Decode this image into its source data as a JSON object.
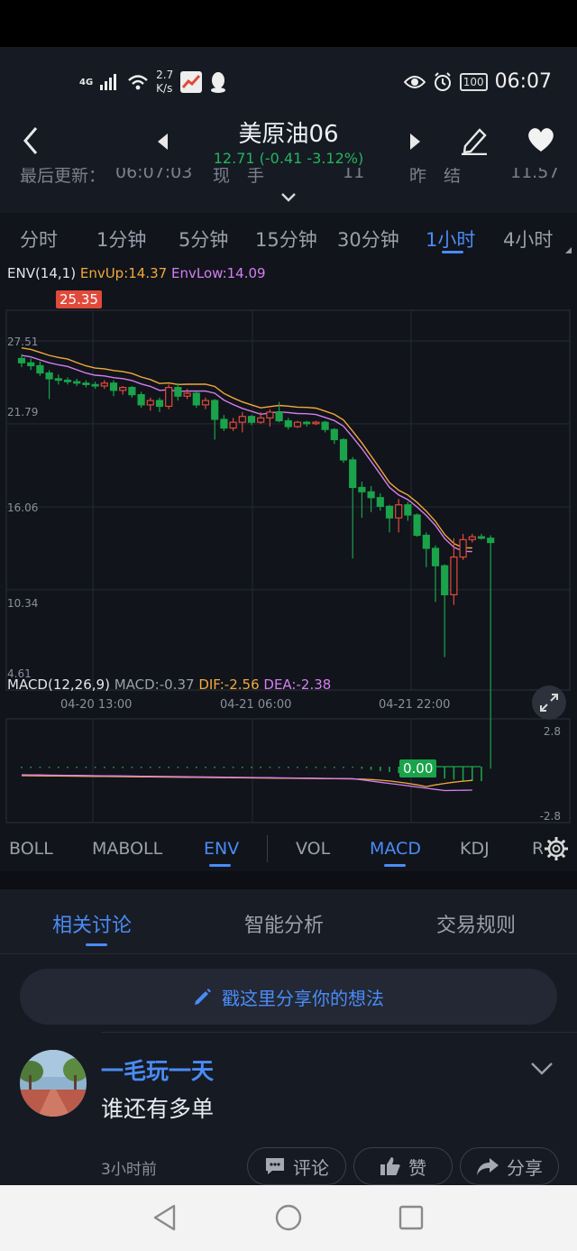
{
  "status_bar": {
    "network": "4G",
    "speed_value": "2.7",
    "speed_unit": "K/s",
    "battery": "100",
    "time": "06:07"
  },
  "header": {
    "title": "美原油06",
    "price": "12.71",
    "change": "(-0.41 -3.12%)"
  },
  "summary_row": {
    "last_update_label": "最后更新：",
    "last_update_time": "06:07:03",
    "current_label": "现　手",
    "current_value": "11",
    "prev_label": "昨　结",
    "prev_value": "11.57"
  },
  "period_tabs": [
    "分时",
    "1分钟",
    "5分钟",
    "15分钟",
    "30分钟",
    "1小时",
    "4小时"
  ],
  "period_active": "1小时",
  "env_legend": {
    "label": "ENV(14,1)",
    "up": "EnvUp:14.37",
    "low": "EnvLow:14.09"
  },
  "macd_legend": {
    "label": "MACD(12,26,9)",
    "macd": "MACD:-0.37",
    "dif": "DIF:-2.56",
    "dea": "DEA:-2.38"
  },
  "price_tag": "25.35",
  "zero_tag": "0.00",
  "chart_data": {
    "type": "candlestick",
    "y_ticks": [
      "27.51",
      "21.79",
      "16.06",
      "10.34",
      "4.61"
    ],
    "x_ticks": [
      "04-20 13:00",
      "04-21 06:00",
      "04-21 22:00"
    ],
    "macd_ticks": [
      "2.8",
      "-2.8"
    ],
    "ylim": [
      4.61,
      27.51
    ],
    "candles": [
      {
        "o": 26.3,
        "c": 26.0,
        "h": 26.6,
        "l": 25.7
      },
      {
        "o": 26.0,
        "c": 25.8,
        "h": 26.3,
        "l": 25.5
      },
      {
        "o": 25.8,
        "c": 25.3,
        "h": 26.1,
        "l": 25.1
      },
      {
        "o": 25.3,
        "c": 24.9,
        "h": 25.5,
        "l": 23.5
      },
      {
        "o": 24.9,
        "c": 24.8,
        "h": 25.2,
        "l": 24.5
      },
      {
        "o": 24.8,
        "c": 24.7,
        "h": 25.0,
        "l": 24.5
      },
      {
        "o": 24.7,
        "c": 24.6,
        "h": 24.9,
        "l": 24.4
      },
      {
        "o": 24.6,
        "c": 24.5,
        "h": 24.8,
        "l": 24.3
      },
      {
        "o": 24.5,
        "c": 24.4,
        "h": 24.7,
        "l": 24.2
      },
      {
        "o": 24.4,
        "c": 24.6,
        "h": 24.8,
        "l": 24.2
      },
      {
        "o": 24.6,
        "c": 24.1,
        "h": 24.8,
        "l": 23.7
      },
      {
        "o": 24.1,
        "c": 24.3,
        "h": 24.4,
        "l": 23.8
      },
      {
        "o": 24.3,
        "c": 23.8,
        "h": 24.4,
        "l": 23.6
      },
      {
        "o": 23.8,
        "c": 23.1,
        "h": 24.0,
        "l": 22.9
      },
      {
        "o": 23.1,
        "c": 23.4,
        "h": 23.6,
        "l": 22.7
      },
      {
        "o": 23.4,
        "c": 23.0,
        "h": 23.6,
        "l": 22.6
      },
      {
        "o": 23.0,
        "c": 24.3,
        "h": 24.5,
        "l": 22.8
      },
      {
        "o": 24.3,
        "c": 23.7,
        "h": 24.6,
        "l": 23.4
      },
      {
        "o": 23.7,
        "c": 23.9,
        "h": 24.2,
        "l": 23.5
      },
      {
        "o": 23.9,
        "c": 23.1,
        "h": 24.0,
        "l": 22.9
      },
      {
        "o": 23.1,
        "c": 23.4,
        "h": 23.6,
        "l": 22.8
      },
      {
        "o": 23.4,
        "c": 22.1,
        "h": 23.5,
        "l": 20.7
      },
      {
        "o": 22.1,
        "c": 21.5,
        "h": 22.4,
        "l": 21.3
      },
      {
        "o": 21.5,
        "c": 21.9,
        "h": 22.2,
        "l": 21.3
      },
      {
        "o": 21.9,
        "c": 22.3,
        "h": 22.6,
        "l": 21.2
      },
      {
        "o": 22.3,
        "c": 21.9,
        "h": 22.4,
        "l": 21.7
      },
      {
        "o": 21.9,
        "c": 22.2,
        "h": 22.6,
        "l": 21.8
      },
      {
        "o": 22.2,
        "c": 22.6,
        "h": 22.8,
        "l": 21.6
      },
      {
        "o": 22.6,
        "c": 22.0,
        "h": 23.3,
        "l": 21.9
      },
      {
        "o": 22.0,
        "c": 21.6,
        "h": 22.2,
        "l": 21.4
      },
      {
        "o": 21.6,
        "c": 21.9,
        "h": 22.0,
        "l": 21.5
      },
      {
        "o": 21.9,
        "c": 21.8,
        "h": 22.0,
        "l": 21.6
      },
      {
        "o": 21.8,
        "c": 21.9,
        "h": 22.0,
        "l": 21.7
      },
      {
        "o": 21.9,
        "c": 21.4,
        "h": 22.0,
        "l": 21.2
      },
      {
        "o": 21.4,
        "c": 20.7,
        "h": 21.5,
        "l": 20.4
      },
      {
        "o": 20.7,
        "c": 19.3,
        "h": 20.8,
        "l": 19.1
      },
      {
        "o": 19.3,
        "c": 17.4,
        "h": 19.5,
        "l": 12.5
      },
      {
        "o": 17.4,
        "c": 17.1,
        "h": 17.8,
        "l": 15.3
      },
      {
        "o": 17.1,
        "c": 16.7,
        "h": 17.5,
        "l": 15.7
      },
      {
        "o": 16.7,
        "c": 16.1,
        "h": 17.0,
        "l": 15.8
      },
      {
        "o": 16.1,
        "c": 15.3,
        "h": 16.2,
        "l": 14.3
      },
      {
        "o": 15.3,
        "c": 16.2,
        "h": 16.6,
        "l": 14.3
      },
      {
        "o": 16.2,
        "c": 15.5,
        "h": 16.4,
        "l": 15.1
      },
      {
        "o": 15.5,
        "c": 14.1,
        "h": 15.6,
        "l": 14.0
      },
      {
        "o": 14.1,
        "c": 13.2,
        "h": 14.3,
        "l": 11.9
      },
      {
        "o": 13.2,
        "c": 12.0,
        "h": 13.4,
        "l": 9.5
      },
      {
        "o": 12.0,
        "c": 10.0,
        "h": 12.1,
        "l": 5.7
      },
      {
        "o": 10.0,
        "c": 12.6,
        "h": 13.9,
        "l": 9.3
      },
      {
        "o": 12.6,
        "c": 13.8,
        "h": 14.2,
        "l": 12.4
      },
      {
        "o": 13.8,
        "c": 14.0,
        "h": 14.2,
        "l": 13.6
      },
      {
        "o": 14.0,
        "c": 13.9,
        "h": 14.2,
        "l": 13.8
      },
      {
        "o": 13.9,
        "c": 13.6,
        "h": 14.1,
        "l": -2.0
      }
    ]
  },
  "indicator_tabs": [
    "BOLL",
    "MABOLL",
    "ENV",
    "VOL",
    "MACD",
    "KDJ",
    "R"
  ],
  "indicator_active": [
    "ENV",
    "MACD"
  ],
  "discussion_tabs": [
    "相关讨论",
    "智能分析",
    "交易规则"
  ],
  "discussion_active": "相关讨论",
  "share_placeholder": "戳这里分享你的想法",
  "post": {
    "username": "一毛玩一天",
    "content": "谁还有多单",
    "time": "3小时前",
    "comment_label": "评论",
    "like_label": "赞",
    "share_label": "分享"
  },
  "colors": {
    "up": "#e04a3a",
    "down": "#1aa34a",
    "accent": "#4a8cf7",
    "env_up": "#f2a93b",
    "env_low": "#d57ef0"
  }
}
